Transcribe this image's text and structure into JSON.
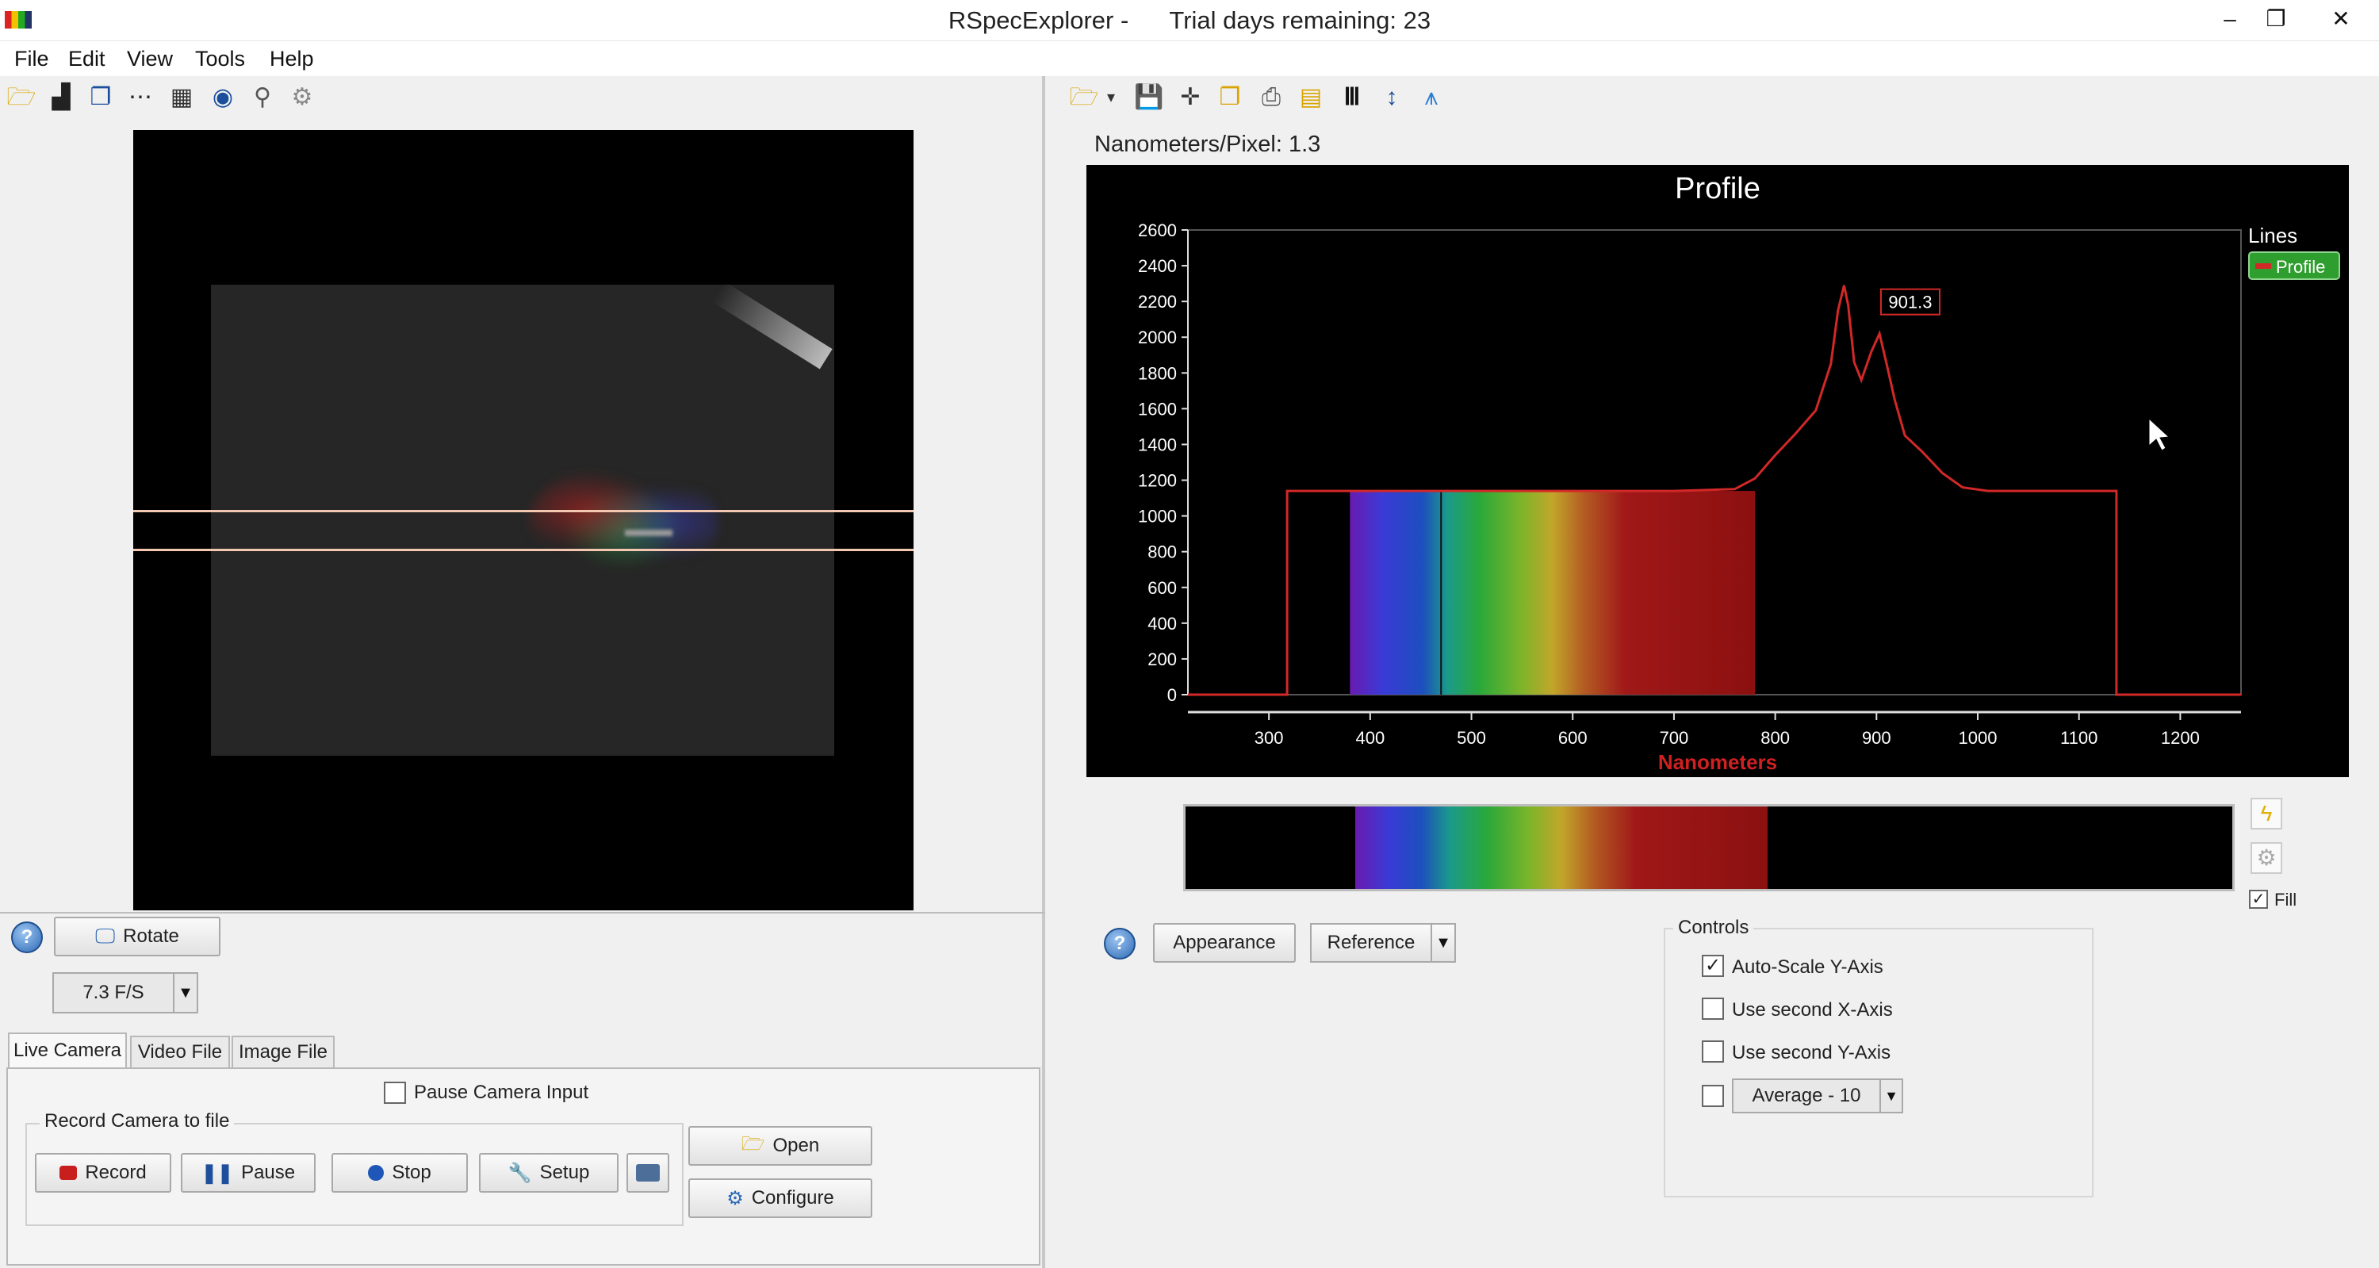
{
  "window": {
    "title": "RSpecExplorer -      Trial days remaining: 23",
    "minimize": "–",
    "restore": "❐",
    "close": "✕"
  },
  "menu": [
    "File",
    "Edit",
    "View",
    "Tools",
    "Help"
  ],
  "left": {
    "rotate_label": "Rotate",
    "fps_value": "7.3 F/S",
    "tabs": [
      "Live Camera",
      "Video File",
      "Image File"
    ],
    "pause_camera_label": "Pause Camera Input",
    "record_group_label": "Record Camera to file",
    "record_label": "Record",
    "pause_label": "Pause",
    "stop_label": "Stop",
    "setup_label": "Setup",
    "open_label": "Open",
    "configure_label": "Configure"
  },
  "right": {
    "nm_per_pixel": "Nanometers/Pixel: 1.3",
    "appearance_label": "Appearance",
    "reference_label": "Reference",
    "fill_label": "Fill",
    "controls_label": "Controls",
    "auto_scale_label": "Auto-Scale Y-Axis",
    "second_x_label": "Use second X-Axis",
    "second_y_label": "Use second Y-Axis",
    "average_value": "Average - 10"
  },
  "colors": {
    "accent": "#cc1f1f",
    "plot_bg": "#000000",
    "legend_green": "#2e9e2e"
  },
  "chart_data": {
    "type": "line",
    "title": "Profile",
    "xlabel": "Nanometers",
    "ylabel": "",
    "xlim": [
      220,
      1260
    ],
    "ylim": [
      0,
      2600
    ],
    "x_ticks": [
      300,
      400,
      500,
      600,
      700,
      800,
      900,
      1000,
      1100,
      1200
    ],
    "y_ticks": [
      0,
      200,
      400,
      600,
      800,
      1000,
      1200,
      1400,
      1600,
      1800,
      2000,
      2200,
      2400,
      2600
    ],
    "legend_title": "Lines",
    "legend_position": "top-right",
    "grid": false,
    "series": [
      {
        "name": "Profile",
        "x": [
          220,
          318,
          318,
          380,
          470,
          500,
          600,
          700,
          760,
          780,
          800,
          820,
          840,
          855,
          862,
          868,
          872,
          878,
          885,
          895,
          903,
          910,
          918,
          928,
          945,
          965,
          985,
          1010,
          1050,
          1100,
          1137,
          1137,
          1260
        ],
        "y": [
          0,
          0,
          1140,
          1140,
          1140,
          1140,
          1140,
          1140,
          1150,
          1210,
          1340,
          1460,
          1590,
          1850,
          2150,
          2290,
          2180,
          1860,
          1760,
          1920,
          2020,
          1850,
          1650,
          1450,
          1360,
          1240,
          1160,
          1140,
          1140,
          1140,
          1140,
          0,
          0
        ]
      }
    ],
    "annotation": {
      "text": "901.3",
      "x": 901.3
    }
  }
}
